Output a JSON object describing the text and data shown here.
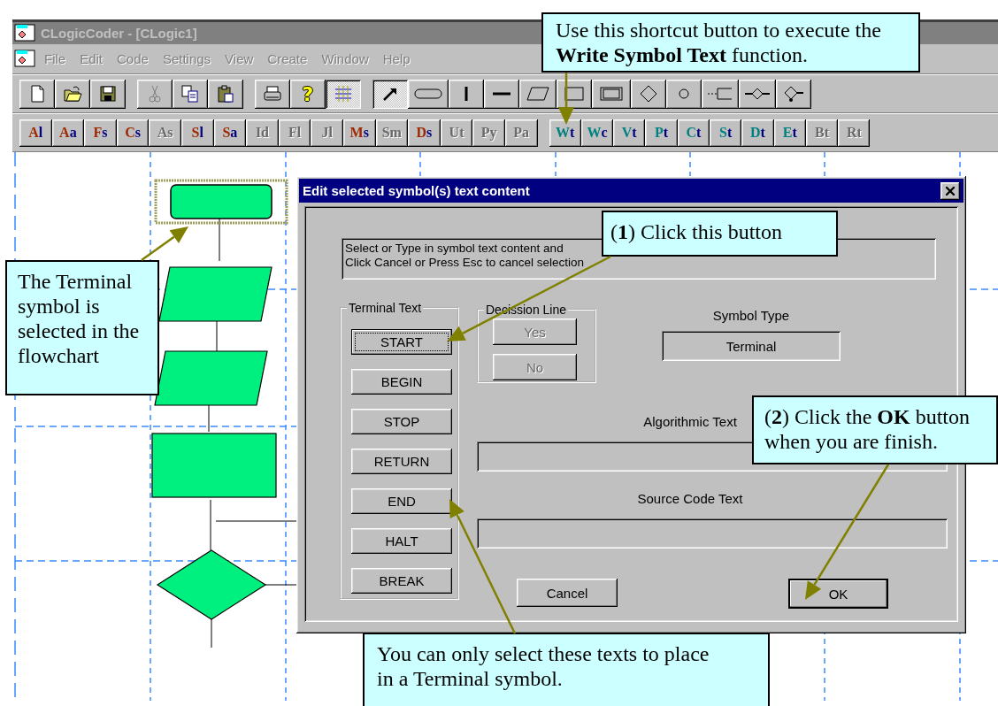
{
  "app": {
    "title": "CLogicCoder - [CLogic1]",
    "menu": [
      {
        "label": "File",
        "disabled": true
      },
      {
        "label": "Edit",
        "disabled": true
      },
      {
        "label": "Code",
        "disabled": true
      },
      {
        "label": "Settings",
        "disabled": true
      },
      {
        "label": "View",
        "disabled": true
      },
      {
        "label": "Create",
        "disabled": true
      },
      {
        "label": "Window",
        "disabled": true
      },
      {
        "label": "Help",
        "disabled": true
      }
    ]
  },
  "toolbar": {
    "groups": [
      [
        {
          "kind": "new",
          "pressed": false
        },
        {
          "kind": "open",
          "pressed": false
        },
        {
          "kind": "save",
          "pressed": false
        }
      ],
      [
        {
          "kind": "cut",
          "pressed": false
        },
        {
          "kind": "copy",
          "pressed": false
        },
        {
          "kind": "paste",
          "pressed": false
        }
      ],
      [
        {
          "kind": "print",
          "pressed": false
        },
        {
          "kind": "help",
          "glyph": "?",
          "pressed": false
        },
        {
          "kind": "grid",
          "pressed": true
        }
      ],
      [
        {
          "kind": "select",
          "pressed": true
        },
        {
          "kind": "terminal",
          "pressed": false
        },
        {
          "kind": "vline",
          "pressed": false
        },
        {
          "kind": "hline",
          "pressed": false
        },
        {
          "kind": "data",
          "pressed": false
        },
        {
          "kind": "process",
          "pressed": false
        },
        {
          "kind": "predefined",
          "pressed": false
        },
        {
          "kind": "decision",
          "pressed": false
        },
        {
          "kind": "connector",
          "pressed": false
        },
        {
          "kind": "offpage",
          "pressed": false
        },
        {
          "kind": "branch",
          "pressed": false
        },
        {
          "kind": "junction",
          "pressed": false
        }
      ]
    ]
  },
  "shortcut_bar": {
    "groups": [
      {
        "kind": "format",
        "buttons": [
          {
            "label": "Al",
            "disabled": false
          },
          {
            "label": "Aa",
            "disabled": false
          },
          {
            "label": "Fs",
            "disabled": false
          },
          {
            "label": "Cs",
            "disabled": false
          },
          {
            "label": "As",
            "disabled": true
          },
          {
            "label": "Sl",
            "disabled": false
          },
          {
            "label": "Sa",
            "disabled": false
          },
          {
            "label": "Id",
            "disabled": true
          },
          {
            "label": "Fl",
            "disabled": true
          },
          {
            "label": "Jl",
            "disabled": true
          },
          {
            "label": "Ms",
            "disabled": false
          },
          {
            "label": "Sm",
            "disabled": true
          },
          {
            "label": "Ds",
            "disabled": false
          },
          {
            "label": "Ut",
            "disabled": true
          },
          {
            "label": "Py",
            "disabled": true
          },
          {
            "label": "Pa",
            "disabled": true
          }
        ]
      },
      {
        "kind": "write",
        "buttons": [
          {
            "label": "Wt",
            "disabled": false
          },
          {
            "label": "Wc",
            "disabled": false
          },
          {
            "label": "Vt",
            "disabled": false
          },
          {
            "label": "Pt",
            "disabled": false
          },
          {
            "label": "Ct",
            "disabled": false
          },
          {
            "label": "St",
            "disabled": false
          },
          {
            "label": "Dt",
            "disabled": false
          },
          {
            "label": "Et",
            "disabled": false
          },
          {
            "label": "Bt",
            "disabled": true
          },
          {
            "label": "Rt",
            "disabled": true
          }
        ]
      }
    ]
  },
  "flowchart": {
    "nodes": [
      {
        "kind": "terminal",
        "selected": true
      },
      {
        "kind": "data",
        "selected": false
      },
      {
        "kind": "data",
        "selected": false
      },
      {
        "kind": "process",
        "selected": false
      },
      {
        "kind": "decision",
        "selected": false
      }
    ]
  },
  "dialog": {
    "title": "Edit selected symbol(s) text content",
    "message": [
      "Select or Type in symbol text content and",
      "Click Cancel or Press Esc to  cancel selection"
    ],
    "terminal_group": {
      "label": "Terminal Text",
      "buttons": [
        {
          "label": "START",
          "selected": true
        },
        {
          "label": "BEGIN",
          "selected": false
        },
        {
          "label": "STOP",
          "selected": false
        },
        {
          "label": "RETURN",
          "selected": false
        },
        {
          "label": "END",
          "selected": false
        },
        {
          "label": "HALT",
          "selected": false
        },
        {
          "label": "BREAK",
          "selected": false
        }
      ]
    },
    "decision_group": {
      "label": "Decission Line",
      "buttons": [
        {
          "label": "Yes",
          "disabled": true
        },
        {
          "label": "No",
          "disabled": true
        }
      ]
    },
    "symbol_type": {
      "label": "Symbol Type",
      "value": "Terminal"
    },
    "algorithmic_text": {
      "label": "Algorithmic Text"
    },
    "source_code_text": {
      "label": "Source Code Text"
    },
    "buttons": [
      {
        "label": "Cancel",
        "default": false
      },
      {
        "label": "OK",
        "default": true
      }
    ]
  },
  "callouts": [
    {
      "text": "Use this shortcut button to execute the **Write Symbol Text** function."
    },
    {
      "text": "The Terminal symbol is selected in the flowchart"
    },
    {
      "text": "(**1**) Click this button"
    },
    {
      "text": "(**2**) Click the **OK** button when you are finish."
    },
    {
      "text": "You can only select these texts to place in a Terminal symbol."
    }
  ]
}
